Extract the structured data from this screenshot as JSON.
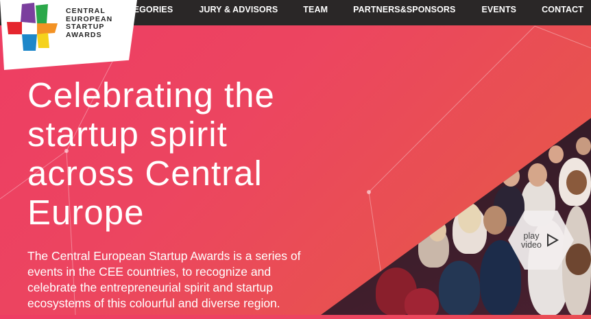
{
  "brand": {
    "name_lines": [
      "CENTRAL",
      "EUROPEAN",
      "STARTUP",
      "AWARDS"
    ],
    "colors": {
      "purple": "#7b3f9e",
      "green": "#2ba84a",
      "orange": "#f39224",
      "red": "#e5262e",
      "blue": "#1d87c9",
      "yellow": "#f5d21b"
    }
  },
  "nav": {
    "items": [
      {
        "label": "CATEGORIES"
      },
      {
        "label": "JURY & ADVISORS"
      },
      {
        "label": "TEAM"
      },
      {
        "label": "PARTNERS&SPONSORS"
      },
      {
        "label": "EVENTS"
      },
      {
        "label": "CONTACT"
      }
    ]
  },
  "hero": {
    "headline_lines": [
      "Celebrating the",
      "startup spirit",
      "across Central",
      "Europe"
    ],
    "description_lines": [
      "The Central European Startup Awards is a series of",
      "events in the CEE countries, to recognize and",
      "celebrate the entrepreneurial spirit and startup",
      "ecosystems of this colourful and diverse region."
    ]
  },
  "video": {
    "label_line1": "play",
    "label_line2": "video",
    "icon": "play-triangle-icon"
  },
  "theme": {
    "topbar_bg": "#2a2727",
    "hero_gradient_start": "#ee3d63",
    "hero_gradient_end": "#e85a48"
  }
}
